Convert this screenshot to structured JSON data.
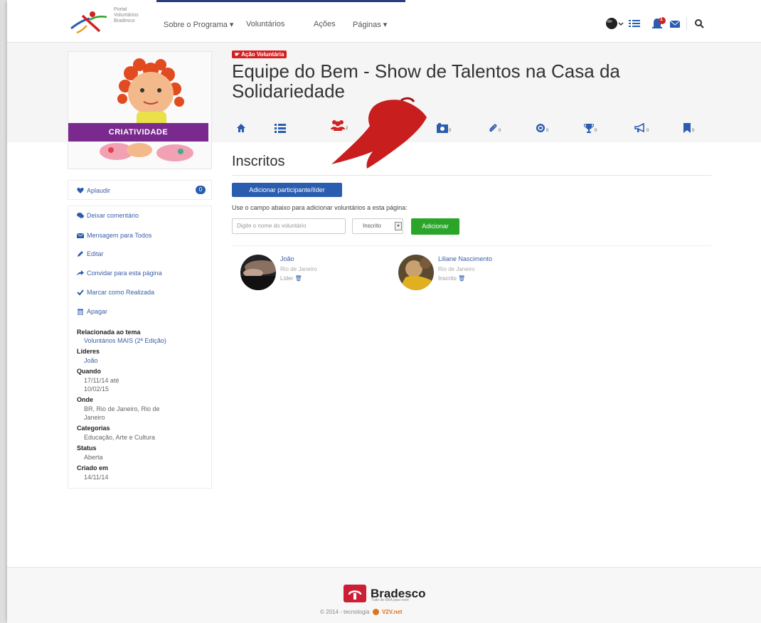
{
  "brand": {
    "logo_lines": [
      "Portal",
      "Voluntários",
      "Bradesco"
    ]
  },
  "nav": {
    "items": [
      "Sobre o Programa ▾",
      "Voluntários",
      "Ações",
      "Páginas ▾"
    ],
    "notification_count": "1"
  },
  "cover": {
    "band_label": "CRIATIVIDADE"
  },
  "sidebar": {
    "applaud_label": "Aplaudir",
    "applaud_count": "0",
    "actions": [
      "Deixar comentário",
      "Mensagem para Todos",
      "Editar",
      "Convidar para esta página",
      "Marcar como Realizada",
      "Apagar"
    ],
    "meta": {
      "related_label": "Relacionada ao tema",
      "related_value": "Voluntários MAIS (2ª Edição)",
      "leaders_label": "Líderes",
      "leaders_value": "João",
      "when_label": "Quando",
      "when_value_1": "17/11/14 até",
      "when_value_2": "10/02/15",
      "where_label": "Onde",
      "where_value_1": "BR, Rio de Janeiro, Rio de",
      "where_value_2": "Janeiro",
      "categories_label": "Categorias",
      "categories_value": "Educação, Arte e Cultura",
      "status_label": "Status",
      "status_value": "Aberta",
      "created_label": "Criado em",
      "created_value": "14/11/14"
    }
  },
  "page": {
    "badge": "Ação Voluntária",
    "title": "Equipe do Bem - Show de Talentos na Casa da Solidariedade",
    "tabs": [
      {
        "icon": "home-icon",
        "count": ""
      },
      {
        "icon": "list-icon",
        "count": ""
      },
      {
        "icon": "users-icon",
        "count": "2"
      },
      {
        "icon": "photo-icon",
        "count": "0"
      },
      {
        "icon": "paperclip-icon",
        "count": "0"
      },
      {
        "icon": "target-icon",
        "count": "0"
      },
      {
        "icon": "trophy-icon",
        "count": "0"
      },
      {
        "icon": "megaphone-icon",
        "count": "0"
      },
      {
        "icon": "bookmark-icon",
        "count": "0"
      }
    ],
    "section_title": "Inscritos",
    "add_button": "Adicionar participante/líder",
    "help_text": "Use o campo abaixo para adicionar voluntários a esta página:",
    "name_placeholder": "Digite o nome do voluntário",
    "role_select": "Inscrito",
    "submit_button": "Adicionar"
  },
  "members": [
    {
      "name": "João",
      "city": "Rio de Janeiro",
      "role": "Líder"
    },
    {
      "name": "Liliane Nascimento",
      "city": "Rio de Janeiro",
      "role": "Inscrito"
    }
  ],
  "footer": {
    "brand_name": "Bradesco",
    "tagline": "Tudo de BRA para você",
    "copyright": "© 2014 - tecnologia",
    "tech_brand": "V2V.net"
  },
  "colors": {
    "accent_blue": "#2a5db0",
    "badge_red": "#d32020",
    "green": "#2aa52a",
    "cover_band": "#7a2a8e",
    "bradesco_red": "#cc1f36"
  }
}
